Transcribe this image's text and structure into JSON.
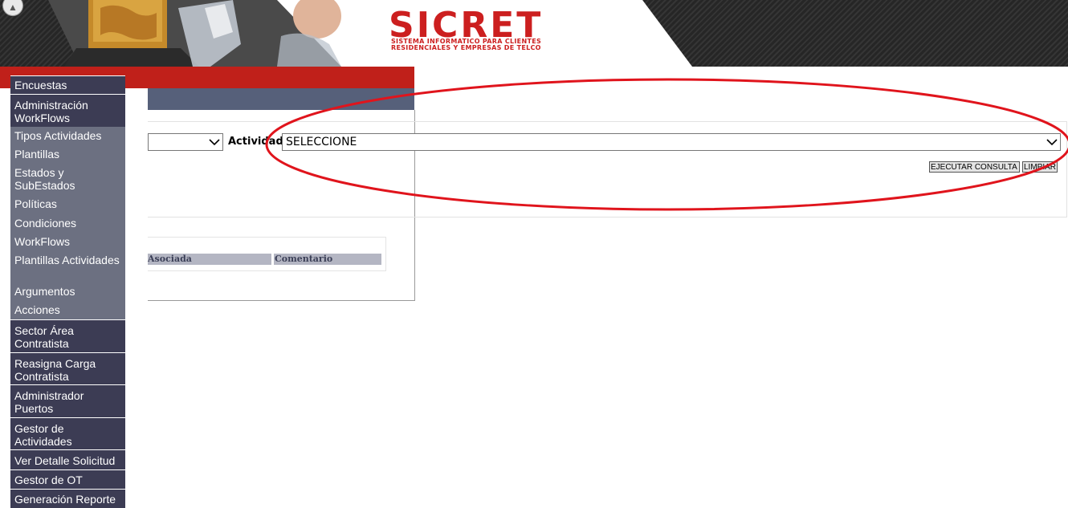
{
  "header": {
    "logo_title": "SICRET",
    "logo_line1": "SISTEMA INFORMATICO PARA CLIENTES",
    "logo_line2": "RESIDENCIALES Y EMPRESAS DE TELCO"
  },
  "menu": {
    "items": [
      {
        "label": "Encuestas"
      },
      {
        "label": "Administración WorkFlows"
      },
      {
        "label": "Tipos Actividades"
      },
      {
        "label": "Plantillas"
      },
      {
        "label": "Estados y SubEstados"
      },
      {
        "label": "Políticas"
      },
      {
        "label": "Condiciones"
      },
      {
        "label": "WorkFlows"
      },
      {
        "label": "Plantillas Actividades"
      },
      {
        "label": "Argumentos"
      },
      {
        "label": "Acciones"
      },
      {
        "label": "Sector Área Contratista"
      },
      {
        "label": "Reasigna Carga Contratista"
      },
      {
        "label": "Administrador Puertos"
      },
      {
        "label": "Gestor de Actividades"
      },
      {
        "label": "Ver Detalle Solicitud"
      },
      {
        "label": "Gestor de OT"
      },
      {
        "label": "Generación Reporte"
      }
    ]
  },
  "filters": {
    "actividad_label": "Actividad",
    "actividad_value": "SELECCIONE",
    "left_select_value": ""
  },
  "buttons": {
    "ejecutar": "EJECUTAR CONSULTA",
    "limpiar": "LIMPIAR"
  },
  "table": {
    "columns": [
      "Asociada",
      "Comentario"
    ]
  },
  "colors": {
    "brand_red": "#c0201a",
    "menu_dark": "#3c3c54",
    "menu_light": "#6c7081",
    "panel_bar": "#56607a"
  }
}
